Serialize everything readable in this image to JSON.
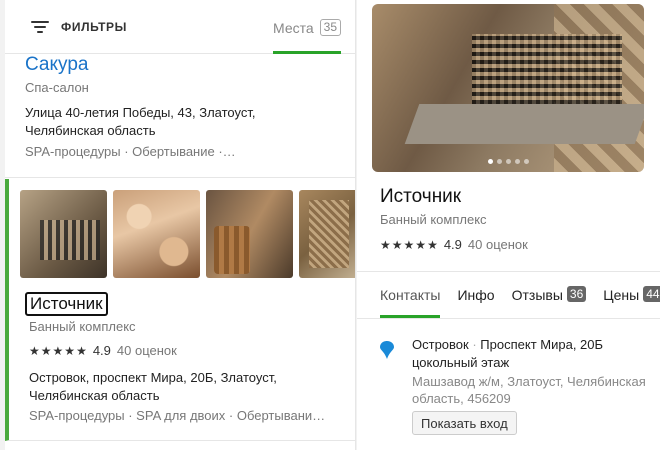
{
  "filters": {
    "label": "ФИЛЬТРЫ",
    "icon": "filter-icon"
  },
  "places_tab": {
    "label": "Места",
    "count": "35",
    "accent": "#29a329"
  },
  "list": [
    {
      "title": "Сакура",
      "category": "Спа-салон",
      "address": "Улица 40-летия Победы, 43, Златоуст, Челябинская область",
      "tags": "SPA-процедуры · Обертывание ·…"
    },
    {
      "title": "Источник",
      "category": "Банный комплекс",
      "rating": "4.9",
      "reviews": "40 оценок",
      "stars": 5,
      "address": "Островок, проспект Мира, 20Б, Златоуст, Челябинская область",
      "tags": "SPA-процедуры · SPA для двоих · Обертывани…",
      "accent": "#4aaa3d"
    }
  ],
  "detail": {
    "title": "Источник",
    "category": "Банный комплекс",
    "rating": "4.9",
    "reviews": "40 оценок",
    "stars": 5,
    "photo_count": 5,
    "active_photo": 1,
    "tabs": [
      {
        "label": "Контакты",
        "active": true
      },
      {
        "label": "Инфо"
      },
      {
        "label": "Отзывы",
        "badge": "36"
      },
      {
        "label": "Цены",
        "badge": "44"
      }
    ],
    "location": {
      "place": "Островок",
      "street": "Проспект Мира, 20Б",
      "floor": "цокольный этаж",
      "area": "Машзавод ж/м, Златоуст, Челябинская область, 456209",
      "pin_color": "#1a8ad8",
      "pin_icon": "location-pin-icon"
    },
    "show_entrance": "Показать вход"
  }
}
